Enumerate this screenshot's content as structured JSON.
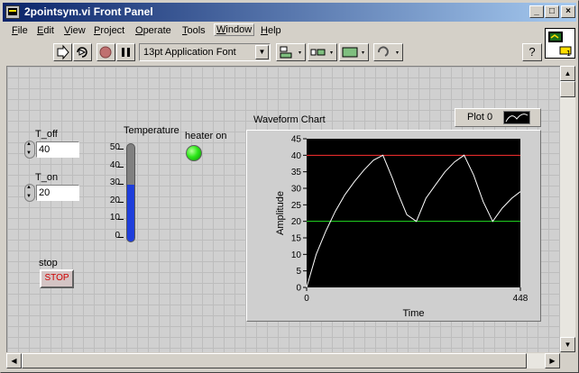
{
  "window": {
    "title": "2pointsym.vi Front Panel",
    "caption_buttons": [
      "_",
      "□",
      "×"
    ]
  },
  "menu": [
    {
      "label": "File",
      "u": "F",
      "rest": "ile"
    },
    {
      "label": "Edit",
      "u": "E",
      "rest": "dit"
    },
    {
      "label": "View",
      "u": "V",
      "rest": "iew"
    },
    {
      "label": "Project",
      "u": "P",
      "rest": "roject"
    },
    {
      "label": "Operate",
      "u": "O",
      "rest": "perate"
    },
    {
      "label": "Tools",
      "u": "T",
      "rest": "ools"
    },
    {
      "label": "Window",
      "u": "W",
      "rest": "indow"
    },
    {
      "label": "Help",
      "u": "H",
      "rest": "elp"
    }
  ],
  "toolbar": {
    "font_select": "13pt Application Font",
    "help_label": "?"
  },
  "controls": {
    "t_off": {
      "label": "T_off",
      "value": "40"
    },
    "t_on": {
      "label": "T_on",
      "value": "20"
    },
    "stop": {
      "label": "stop",
      "button_text": "STOP"
    },
    "heater": {
      "label": "heater on",
      "state": "on",
      "color": "#2ee81a"
    },
    "temperature": {
      "label": "Temperature",
      "ticks": [
        "50",
        "40",
        "30",
        "20",
        "10",
        "0"
      ],
      "min": 0,
      "max": 50,
      "value": 29,
      "fill_color": "#1e3edc"
    }
  },
  "chart_data": {
    "type": "line",
    "title": "Waveform Chart",
    "xlabel": "Time",
    "ylabel": "Amplitude",
    "xlim": [
      0,
      448
    ],
    "ylim": [
      0,
      45
    ],
    "x_ticks": [
      "0",
      "448"
    ],
    "y_ticks": [
      "45",
      "40",
      "35",
      "30",
      "25",
      "20",
      "15",
      "10",
      "5",
      "0"
    ],
    "legend": {
      "name": "Plot 0",
      "placement": "top-right"
    },
    "reference_lines": [
      {
        "y": 40,
        "color": "#ff3030"
      },
      {
        "y": 20,
        "color": "#22dd22"
      }
    ],
    "series": [
      {
        "color": "#ffffff",
        "x": [
          0,
          20,
          40,
          60,
          80,
          100,
          120,
          140,
          160,
          180,
          190,
          210,
          230,
          250,
          270,
          290,
          310,
          330,
          350,
          370,
          390,
          410,
          430,
          448
        ],
        "values": [
          0,
          10,
          17,
          23,
          28,
          32,
          35.5,
          38.5,
          40,
          33,
          29,
          22,
          20,
          27,
          31,
          35,
          38,
          40,
          34,
          26,
          20,
          24,
          27,
          29
        ]
      }
    ]
  }
}
